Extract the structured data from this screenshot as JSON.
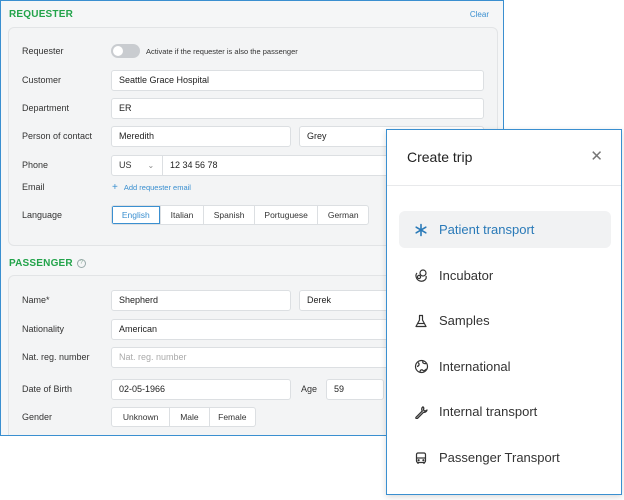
{
  "requester": {
    "title": "REQUESTER",
    "clear_label": "Clear",
    "requester_label": "Requester",
    "toggle_text": "Activate if the requester is also the passenger",
    "customer_label": "Customer",
    "customer_value": "Seattle Grace Hospital",
    "department_label": "Department",
    "department_value": "ER",
    "contact_label": "Person of contact",
    "contact_first": "Meredith",
    "contact_last": "Grey",
    "phone_label": "Phone",
    "phone_country": "US",
    "phone_value": "12 34 56 78",
    "email_label": "Email",
    "add_email_label": "Add requester email",
    "language_label": "Language",
    "languages": [
      "English",
      "Italian",
      "Spanish",
      "Portuguese",
      "German"
    ],
    "selected_language": "English"
  },
  "passenger": {
    "title": "PASSENGER",
    "name_label": "Name*",
    "name_last": "Shepherd",
    "name_first": "Derek",
    "nationality_label": "Nationality",
    "nationality_value": "American",
    "natreg_label": "Nat. reg. number",
    "natreg_placeholder": "Nat. reg. number",
    "dob_label": "Date of Birth",
    "dob_value": "02-05-1966",
    "age_label": "Age",
    "age_value": "59",
    "gender_label": "Gender",
    "genders": [
      "Unknown",
      "Male",
      "Female"
    ]
  },
  "modal": {
    "title": "Create trip",
    "close_icon": "close-icon",
    "items": [
      {
        "label": "Patient transport",
        "icon": "asterisk-icon"
      },
      {
        "label": "Incubator",
        "icon": "incubator-icon"
      },
      {
        "label": "Samples",
        "icon": "flask-icon"
      },
      {
        "label": "International",
        "icon": "globe-icon"
      },
      {
        "label": "Internal transport",
        "icon": "wrench-icon"
      },
      {
        "label": "Passenger Transport",
        "icon": "bus-icon"
      }
    ],
    "active_index": 0
  },
  "colors": {
    "accent": "#3a8fd0",
    "section_title": "#22a34a"
  }
}
